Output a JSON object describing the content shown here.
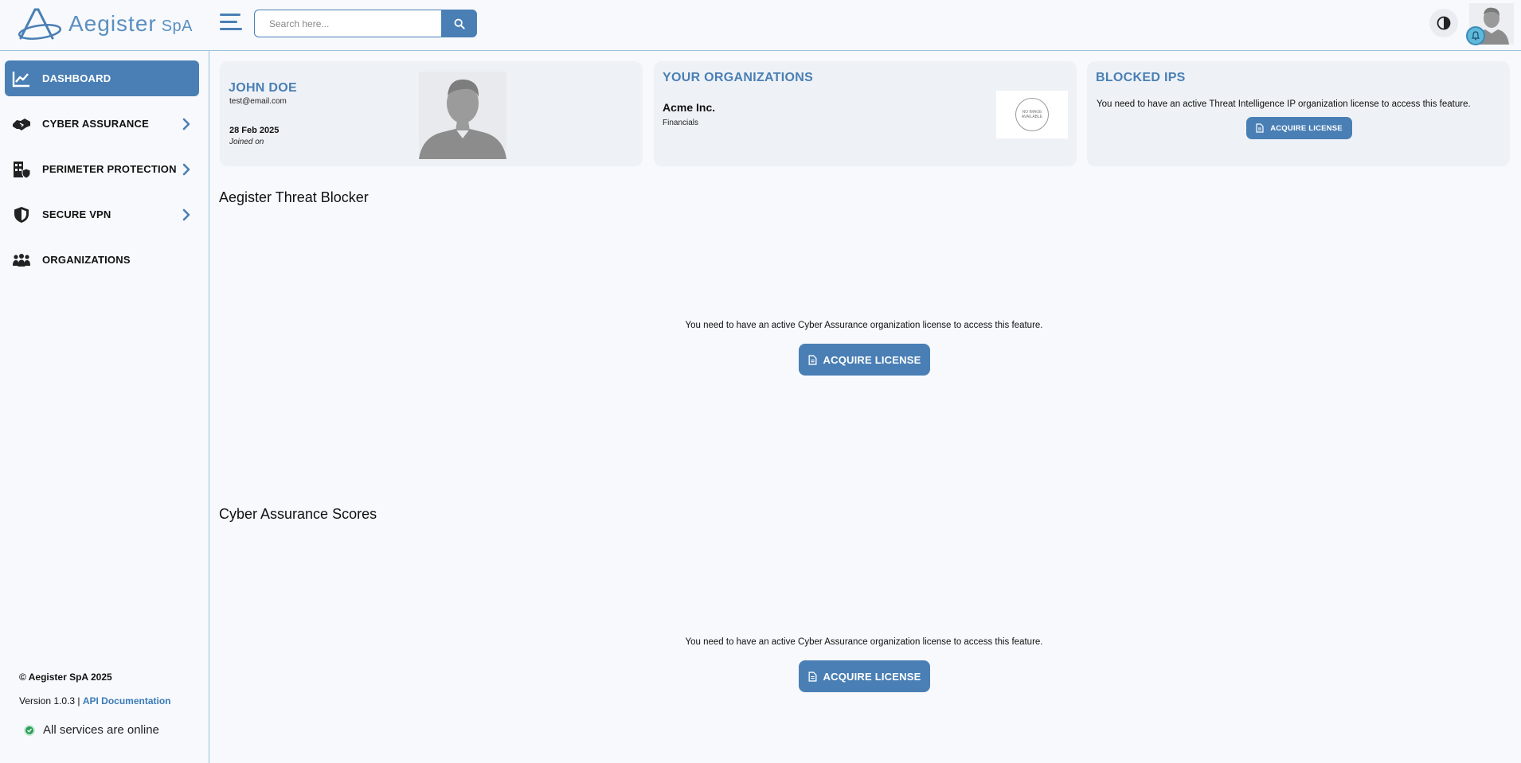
{
  "header": {
    "logo_name": "Aegister",
    "logo_suffix": "SpA",
    "search_placeholder": "Search here...",
    "search_icon": "search-icon",
    "theme_icon": "contrast-icon",
    "notification_icon": "bell-icon"
  },
  "sidebar": {
    "items": [
      {
        "label": "DASHBOARD",
        "icon": "chart-line-icon",
        "active": true
      },
      {
        "label": "CYBER ASSURANCE",
        "icon": "handshake-icon",
        "has_submenu": true
      },
      {
        "label": "PERIMETER PROTECTION",
        "icon": "building-shield-icon",
        "has_submenu": true
      },
      {
        "label": "SECURE VPN",
        "icon": "shield-icon",
        "has_submenu": true
      },
      {
        "label": "ORGANIZATIONS",
        "icon": "people-group-icon"
      }
    ],
    "footer": {
      "copyright": "© Aegister SpA 2025",
      "version": "Version 1.0.3 |",
      "api_link": "API Documentation",
      "status": "All services are online"
    }
  },
  "profile_card": {
    "name": "JOHN DOE",
    "email": "test@email.com",
    "date": "28 Feb 2025",
    "joined_label": "Joined on"
  },
  "organizations_card": {
    "title": "YOUR ORGANIZATIONS",
    "org_name": "Acme Inc.",
    "org_sector": "Financials",
    "no_image_line1": "NO IMAGE",
    "no_image_line2": "AVAILABLE"
  },
  "blocked_ips_card": {
    "title": "BLOCKED IPS",
    "message": "You need to have an active Threat Intelligence IP organization license to access this feature.",
    "button": "ACQUIRE LICENSE"
  },
  "threat_blocker": {
    "title": "Aegister Threat Blocker",
    "message": "You need to have an active Cyber Assurance organization license to access this feature.",
    "button": "ACQUIRE LICENSE"
  },
  "cyber_scores": {
    "title": "Cyber Assurance Scores",
    "message": "You need to have an active Cyber Assurance organization license to access this feature.",
    "button": "ACQUIRE LICENSE"
  },
  "colors": {
    "primary": "#4a7fb5",
    "background": "#f7f9fc",
    "card": "#eef2f6",
    "status_online": "#2e9e5b"
  }
}
